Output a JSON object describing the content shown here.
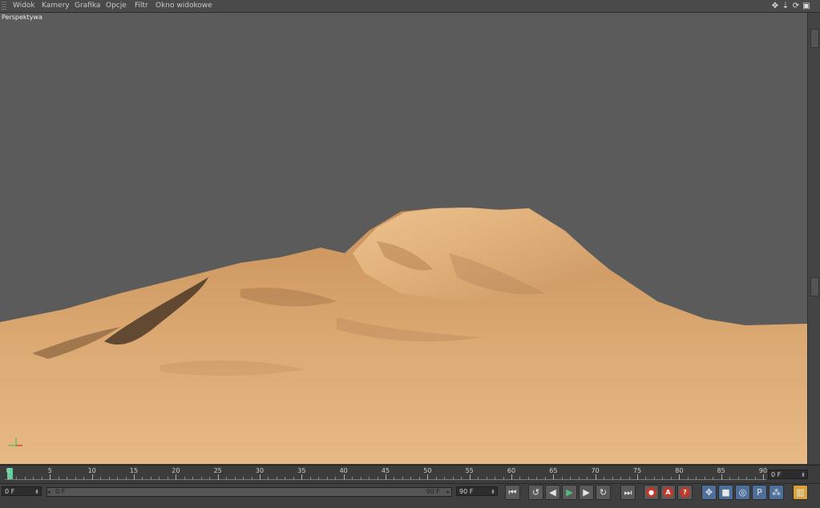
{
  "menu": {
    "items": [
      "Widok",
      "Kamery",
      "Grafika",
      "Opcje",
      "Filtr",
      "Okno widokowe"
    ]
  },
  "nav_icons": [
    "move-view-icon",
    "zoom-view-icon",
    "rotate-view-icon",
    "maximize-view-icon"
  ],
  "viewport": {
    "label": "Perspektywa",
    "background": "#5b5b5b",
    "terrain_color": "#d8a46c"
  },
  "timeline": {
    "labels": [
      "0",
      "5",
      "10",
      "15",
      "20",
      "25",
      "30",
      "35",
      "40",
      "45",
      "50",
      "55",
      "60",
      "65",
      "70",
      "75",
      "80",
      "85",
      "90"
    ],
    "current_frame": "0 F",
    "playhead_color": "#5bd19a"
  },
  "bottom": {
    "start_field": "0 F",
    "range_start": "0 F",
    "range_end": "90 F",
    "end_field": "90 F"
  },
  "transport_icons": [
    "go-to-start-icon",
    "previous-key-icon",
    "step-back-icon",
    "play-forward-icon",
    "step-forward-icon",
    "next-key-icon",
    "go-to-end-icon"
  ],
  "record_icons": [
    "record-icon",
    "autokey-icon",
    "help-icon"
  ],
  "key_icons": [
    "key-position-icon",
    "key-scale-icon",
    "key-rotation-icon",
    "key-parameter-icon",
    "key-pla-icon",
    "timeline-layout-icon"
  ]
}
